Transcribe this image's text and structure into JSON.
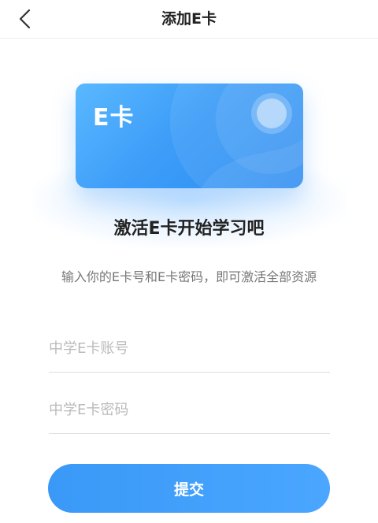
{
  "header": {
    "title": "添加E卡",
    "back_icon": "chevron-left-icon"
  },
  "card": {
    "logo_text": "E卡",
    "colors": {
      "start": "#5ab8ff",
      "end": "#2c8cf2"
    }
  },
  "intro": {
    "title": "激活E卡开始学习吧",
    "subtitle": "输入你的E卡号和E卡密码，即可激活全部资源"
  },
  "form": {
    "account": {
      "value": "",
      "placeholder": "中学E卡账号"
    },
    "password": {
      "value": "",
      "placeholder": "中学E卡密码"
    },
    "submit_label": "提交"
  },
  "colors": {
    "accent": "#3d9df8",
    "text_dark": "#222222",
    "text_muted": "#777777",
    "placeholder": "#bbbbbb"
  }
}
